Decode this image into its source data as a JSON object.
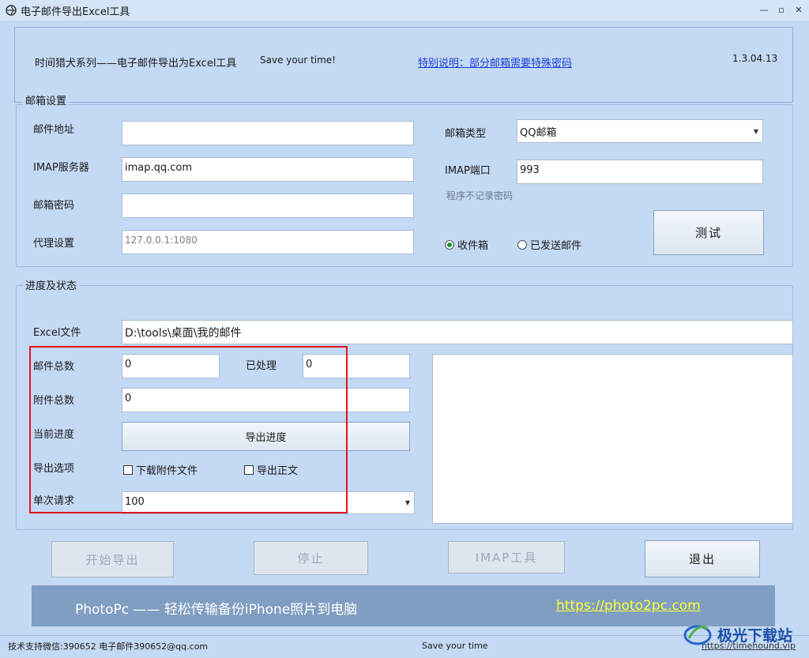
{
  "window": {
    "title": "电子邮件导出Excel工具",
    "minimize_label": "—",
    "restore_label": "▫",
    "close_label": "✕"
  },
  "header": {
    "title": "时间猎犬系列——电子邮件导出为Excel工具",
    "slogan": "Save your time!",
    "notice_link": "特别说明：部分邮箱需要特殊密码",
    "version": "1.3.04.13"
  },
  "mailbox": {
    "group_title": "邮箱设置",
    "email_label": "邮件地址",
    "email_value": "",
    "imap_label": "IMAP服务器",
    "imap_value": "imap.qq.com",
    "password_label": "邮箱密码",
    "password_value": "",
    "proxy_label": "代理设置",
    "proxy_value": "127.0.0.1:1080",
    "type_label": "邮箱类型",
    "type_value": "QQ邮箱",
    "port_label": "IMAP端口",
    "port_value": "993",
    "note": "程序不记录密码",
    "test_button": "测试",
    "radio_inbox": "收件箱",
    "radio_sent": "已发送邮件",
    "selected_folder": "收件箱"
  },
  "progress": {
    "group_title": "进度及状态",
    "excel_label": "Excel文件",
    "excel_value": "D:\\tools\\桌面\\我的邮件",
    "total_label": "邮件总数",
    "total_value": "0",
    "processed_label": "已处理",
    "processed_value": "0",
    "attach_label": "附件总数",
    "attach_value": "0",
    "current_label": "当前进度",
    "progress_button": "导出进度",
    "options_label": "导出选项",
    "opt_download": "下载附件文件",
    "opt_body": "导出正文",
    "batch_label": "单次请求",
    "batch_value": "100"
  },
  "actions": {
    "start": "开始导出",
    "stop": "停止",
    "imap_tool": "IMAP工具",
    "exit": "退出"
  },
  "banner": {
    "text": "PhotoPc —— 轻松传输备份iPhone照片到电脑",
    "link": "https://photo2pc.com"
  },
  "status": {
    "support": "技术支持微信:390652   电子邮件390652@qq.com",
    "center": "Save your time",
    "url": "https://timehound.vip"
  },
  "watermark": {
    "text": "极光下载站"
  },
  "colors": {
    "background": "#c4d9f3",
    "link": "#1a3fd6",
    "banner": "#7f9ec2",
    "highlight": "#e0141e"
  }
}
